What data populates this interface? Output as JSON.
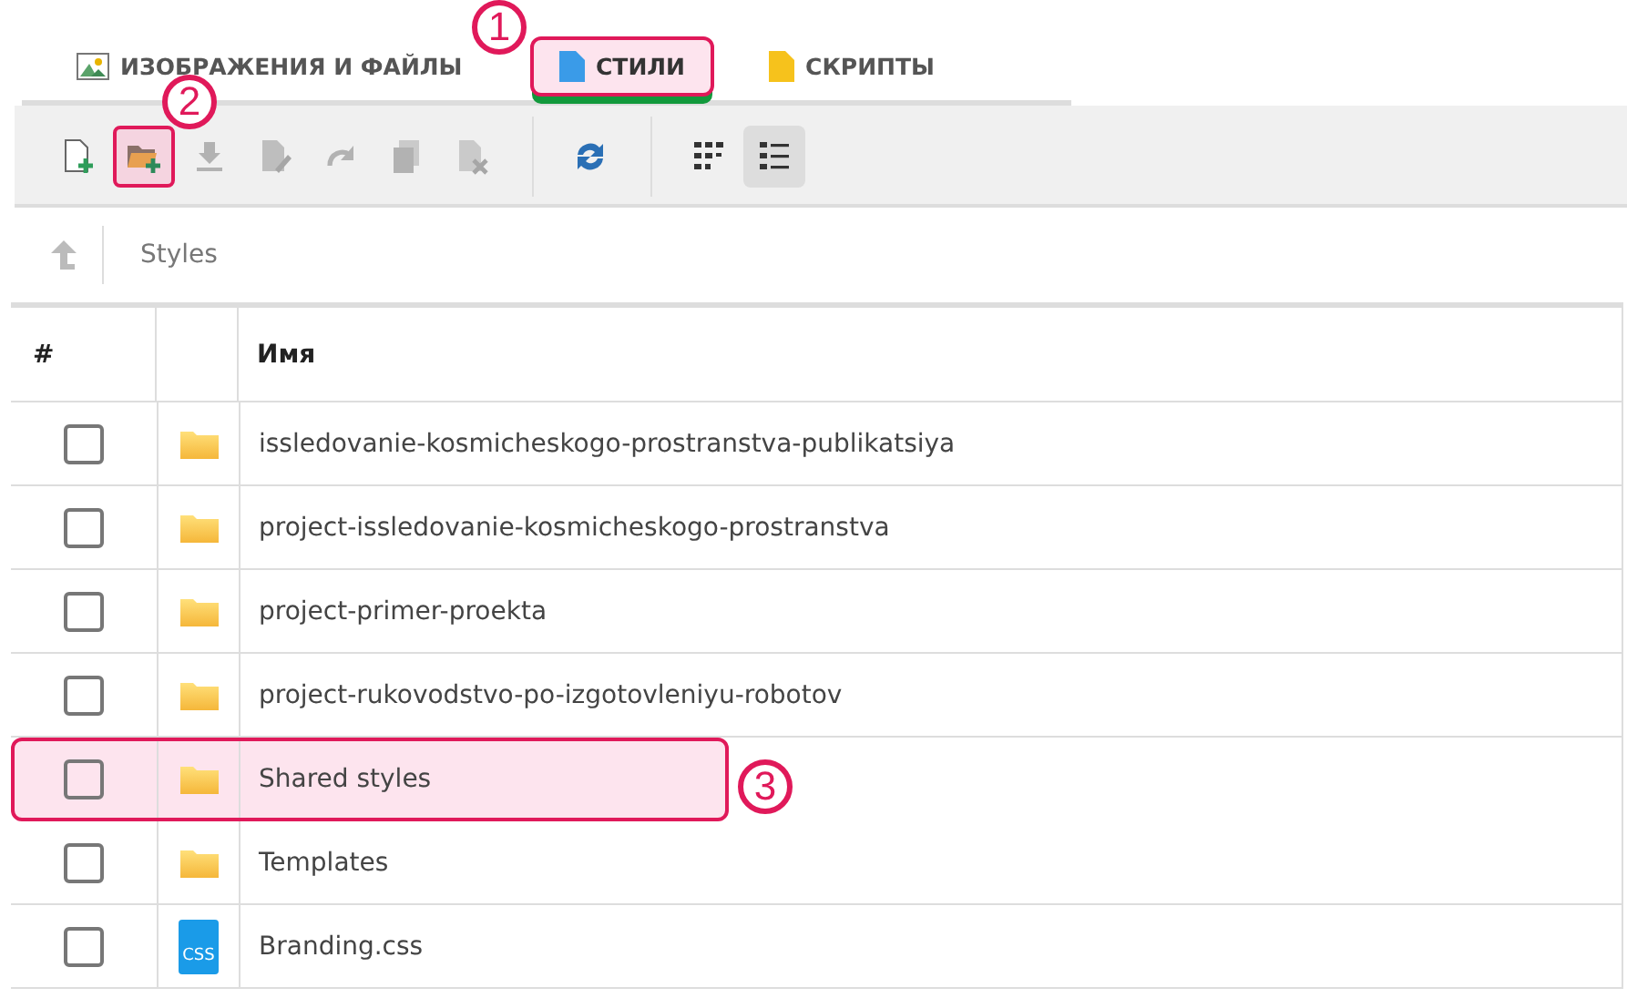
{
  "tabs": [
    {
      "label": "ИЗОБРАЖЕНИЯ И ФАЙЛЫ",
      "kind": "image",
      "selected": false,
      "highlighted": false
    },
    {
      "label": "СТИЛИ",
      "kind": "style",
      "selected": true,
      "highlighted": true,
      "callout": "1"
    },
    {
      "label": "СКРИПТЫ",
      "kind": "script",
      "selected": false,
      "highlighted": false
    }
  ],
  "toolbar": [
    {
      "kind": "new-file",
      "disabled": false,
      "highlighted": false
    },
    {
      "kind": "new-folder",
      "disabled": false,
      "highlighted": true,
      "callout": "2"
    },
    {
      "kind": "download",
      "disabled": true,
      "highlighted": false
    },
    {
      "kind": "rename",
      "disabled": true,
      "highlighted": false
    },
    {
      "kind": "redo",
      "disabled": true,
      "highlighted": false
    },
    {
      "kind": "copy",
      "disabled": true,
      "highlighted": false
    },
    {
      "kind": "delete",
      "disabled": true,
      "highlighted": false
    },
    {
      "kind": "separator"
    },
    {
      "kind": "refresh",
      "disabled": false,
      "highlighted": false
    },
    {
      "kind": "separator"
    },
    {
      "kind": "grid-view",
      "disabled": false,
      "selected": false,
      "highlighted": false
    },
    {
      "kind": "list-view",
      "disabled": false,
      "selected": true,
      "highlighted": false
    }
  ],
  "breadcrumb": {
    "path": "Styles"
  },
  "table": {
    "columns": [
      "#",
      "Имя"
    ],
    "rows": [
      {
        "kind": "folder",
        "name": "issledovanie-kosmicheskogo-prostranstva-publikatsiya",
        "checked": false,
        "highlighted": false
      },
      {
        "kind": "folder",
        "name": "project-issledovanie-kosmicheskogo-prostranstva",
        "checked": false,
        "highlighted": false
      },
      {
        "kind": "folder",
        "name": "project-primer-proekta",
        "checked": false,
        "highlighted": false
      },
      {
        "kind": "folder",
        "name": "project-rukovodstvo-po-izgotovleniyu-robotov",
        "checked": false,
        "highlighted": false
      },
      {
        "kind": "folder",
        "name": "Shared styles",
        "checked": false,
        "highlighted": true,
        "callout": "3"
      },
      {
        "kind": "folder",
        "name": "Templates",
        "checked": false,
        "highlighted": false
      },
      {
        "kind": "css",
        "name": "Branding.css",
        "checked": false,
        "highlighted": false,
        "icon_text": "CSS"
      }
    ]
  }
}
